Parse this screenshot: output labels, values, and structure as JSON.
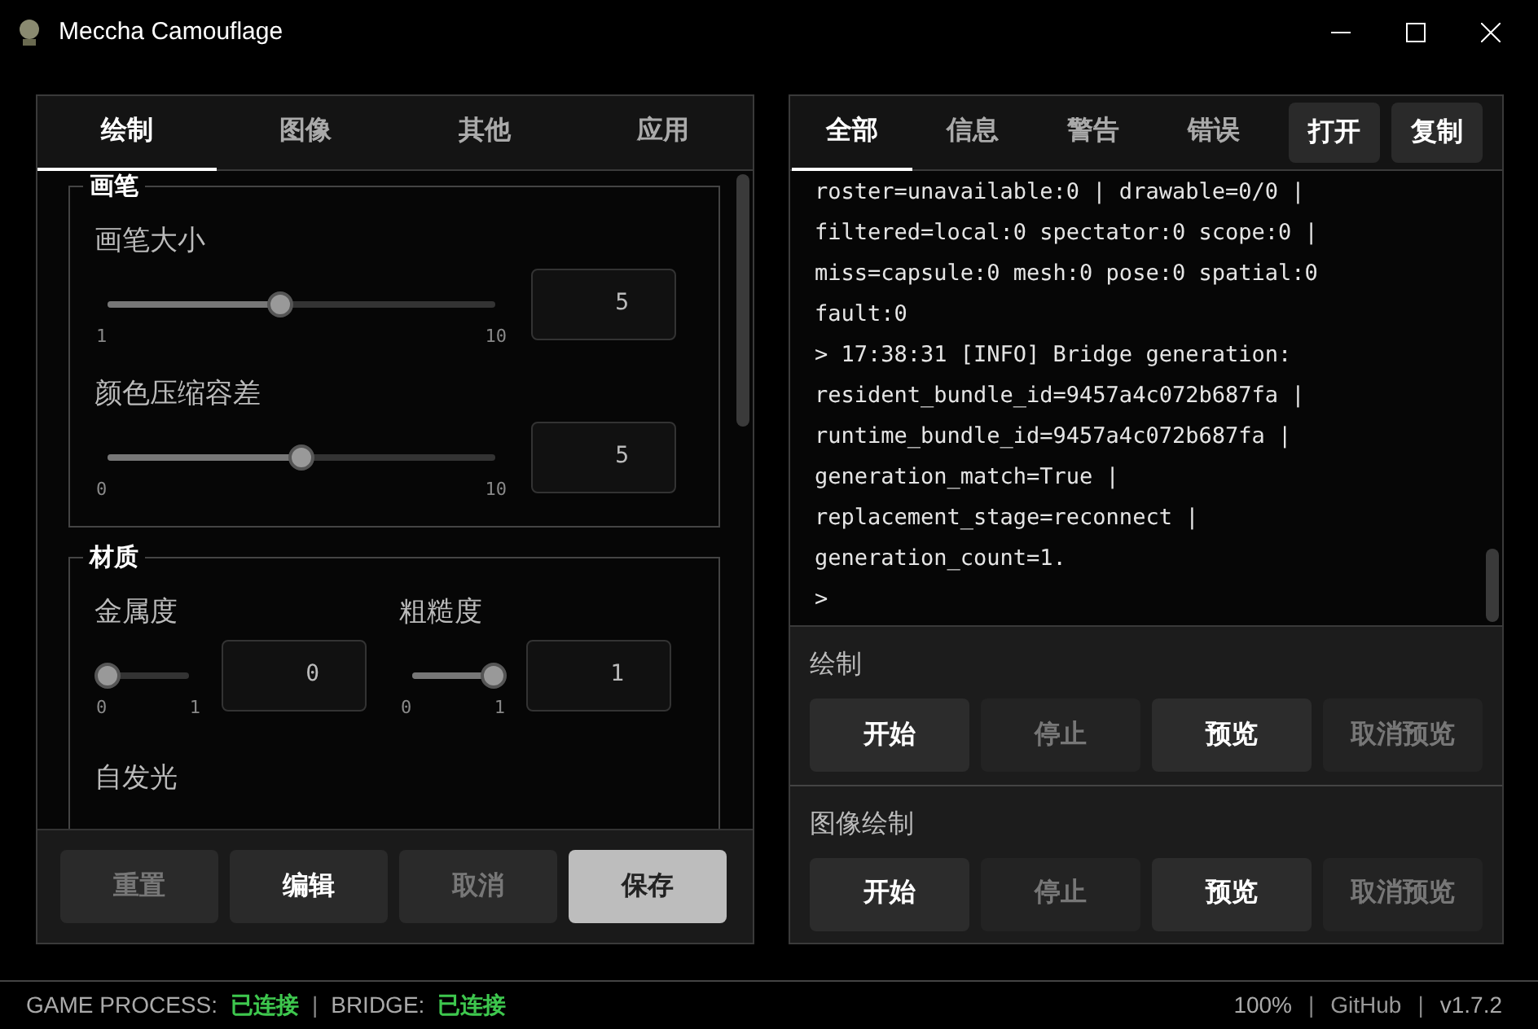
{
  "window": {
    "title": "Meccha Camouflage"
  },
  "left_panel": {
    "tabs": [
      {
        "label": "绘制",
        "selected": true
      },
      {
        "label": "图像",
        "selected": false
      },
      {
        "label": "其他",
        "selected": false
      },
      {
        "label": "应用",
        "selected": false
      }
    ],
    "groups": [
      {
        "title": "画笔",
        "controls": [
          {
            "kind": "slider",
            "label": "画笔大小",
            "min": "1",
            "max": "10",
            "value": "5",
            "level": 0.444
          },
          {
            "kind": "slider",
            "label": "颜色压缩容差",
            "min": "0",
            "max": "10",
            "value": "5",
            "level": 0.5
          }
        ]
      },
      {
        "title": "材质",
        "controls": [
          {
            "kind": "pair",
            "items": [
              {
                "label": "金属度",
                "min": "0",
                "max": "1",
                "value": "0",
                "level": 0
              },
              {
                "label": "粗糙度",
                "min": "0",
                "max": "1",
                "value": "1",
                "level": 1
              }
            ]
          },
          {
            "kind": "label",
            "label": "自发光"
          }
        ]
      }
    ],
    "buttons": [
      {
        "label": "重置",
        "disabled": true,
        "primary": false
      },
      {
        "label": "编辑",
        "disabled": false,
        "primary": false
      },
      {
        "label": "取消",
        "disabled": true,
        "primary": false
      },
      {
        "label": "保存",
        "disabled": false,
        "primary": true
      }
    ]
  },
  "right_panel": {
    "tabs": [
      {
        "label": "全部",
        "selected": true
      },
      {
        "label": "信息",
        "selected": false
      },
      {
        "label": "警告",
        "selected": false
      },
      {
        "label": "错误",
        "selected": false
      }
    ],
    "actions": [
      "打开",
      "复制"
    ],
    "log_lines": [
      "roster=unavailable:0 | drawable=0/0 |",
      "filtered=local:0 spectator:0 scope:0 |",
      "miss=capsule:0 mesh:0 pose:0 spatial:0",
      "fault:0",
      "> 17:38:31 [INFO] Bridge generation:",
      "resident_bundle_id=9457a4c072b687fa |",
      "runtime_bundle_id=9457a4c072b687fa |",
      "generation_match=True |",
      "replacement_stage=reconnect |",
      "generation_count=1.",
      ">"
    ],
    "sections": [
      {
        "title": "绘制",
        "buttons": [
          {
            "label": "开始",
            "disabled": false
          },
          {
            "label": "停止",
            "disabled": true
          },
          {
            "label": "预览",
            "disabled": false
          },
          {
            "label": "取消预览",
            "disabled": true
          }
        ]
      },
      {
        "title": "图像绘制",
        "buttons": [
          {
            "label": "开始",
            "disabled": false
          },
          {
            "label": "停止",
            "disabled": true
          },
          {
            "label": "预览",
            "disabled": false
          },
          {
            "label": "取消预览",
            "disabled": true
          }
        ]
      }
    ]
  },
  "status_bar": {
    "left": [
      {
        "kind": "label",
        "text": "GAME PROCESS:"
      },
      {
        "kind": "ok",
        "text": "已连接"
      },
      {
        "kind": "sep",
        "text": "|"
      },
      {
        "kind": "label",
        "text": "BRIDGE:"
      },
      {
        "kind": "ok",
        "text": "已连接"
      }
    ],
    "right": [
      {
        "kind": "label",
        "text": "100%"
      },
      {
        "kind": "sep",
        "text": "|"
      },
      {
        "kind": "link",
        "text": "GitHub"
      },
      {
        "kind": "sep",
        "text": "|"
      },
      {
        "kind": "label",
        "text": "v1.7.2"
      }
    ]
  }
}
